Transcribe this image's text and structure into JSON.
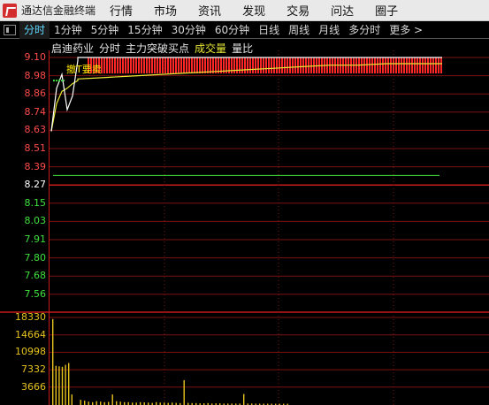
{
  "app": {
    "title": "通达信金融终端"
  },
  "menu": [
    "行情",
    "市场",
    "资讯",
    "发现",
    "交易",
    "问达",
    "圈子"
  ],
  "tabs": [
    "分时",
    "1分钟",
    "5分钟",
    "15分钟",
    "30分钟",
    "60分钟",
    "日线",
    "周线",
    "月线",
    "多分时",
    "更多 >"
  ],
  "active_tab": 0,
  "header": {
    "stock": "启迪药业",
    "mode": "分时",
    "indicator": "主力突破买点",
    "volume": "成交量",
    "ratio": "量比"
  },
  "badge": "撤T要卖",
  "price_axis": {
    "ticks": [
      "9.10",
      "8.98",
      "8.86",
      "8.74",
      "8.63",
      "8.51",
      "8.39",
      "8.27",
      "8.15",
      "8.03",
      "7.91",
      "7.80",
      "7.68",
      "7.56"
    ],
    "prev_close": "8.27"
  },
  "volume_axis": {
    "ticks": [
      "18330",
      "14664",
      "10998",
      "7332",
      "3666"
    ]
  },
  "colors": {
    "up": "#ff4b4b",
    "down": "#3ee03e",
    "grid": "#8b1a1a",
    "active_tab": "#5fd8ff",
    "volume": "#e6c21e"
  },
  "chart_data": {
    "type": "line",
    "title": "",
    "xlabel": "",
    "ylabel": "",
    "ylim": [
      7.5,
      9.12
    ],
    "series": [
      {
        "name": "",
        "values": [
          8.62,
          8.9,
          8.99,
          8.76,
          8.85,
          9.08,
          9.1,
          9.1,
          9.1,
          9.1,
          9.1,
          9.1,
          9.1,
          9.1,
          9.1,
          9.1,
          9.1,
          9.1,
          9.1,
          9.1
        ]
      },
      {
        "name": "",
        "values": [
          8.62,
          8.8,
          8.88,
          8.9,
          8.93,
          8.95,
          8.96,
          8.97,
          8.98,
          8.99,
          9.0,
          9.01,
          9.02,
          9.03,
          9.04,
          9.05,
          9.05,
          9.06,
          9.06,
          9.06
        ]
      }
    ],
    "prev_close": 8.27,
    "limit_up": 9.1,
    "volume": {
      "ylim": [
        0,
        20000
      ],
      "values": [
        18000,
        8200,
        8100,
        8000,
        8400,
        8800,
        2200,
        1100,
        900,
        700,
        600,
        800,
        700,
        600,
        650,
        2200,
        800,
        700,
        600,
        600,
        500,
        500,
        600,
        550,
        500,
        450,
        600,
        500,
        500,
        450,
        500,
        450,
        400,
        5200,
        450,
        400,
        400,
        350,
        350,
        400,
        300,
        350,
        350,
        300,
        300,
        300,
        300,
        300,
        2300,
        300,
        300,
        280,
        280,
        280,
        250,
        250,
        250,
        250,
        250,
        250
      ]
    }
  }
}
